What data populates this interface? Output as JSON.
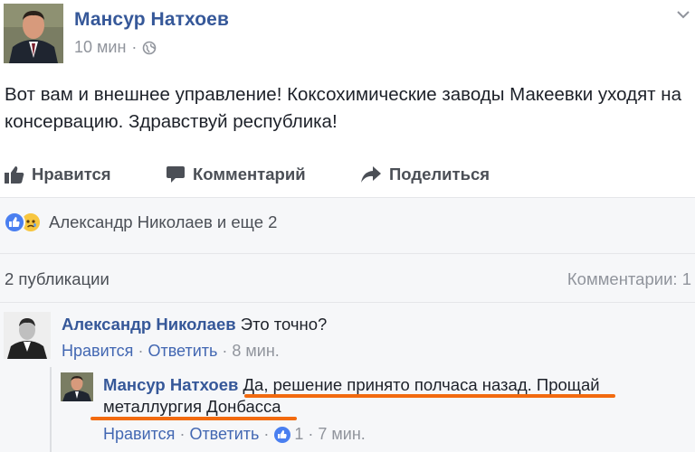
{
  "post": {
    "author": "Мансур Натхоев",
    "time": "10 мин",
    "separator": "·",
    "text": "Вот вам и внешнее управление! Коксохимические заводы Макеевки уходят на консервацию. Здравствуй республика!",
    "privacy_icon": "globe-icon",
    "menu_icon": "chevron-down-icon"
  },
  "actions": {
    "like_label": "Нравится",
    "comment_label": "Комментарий",
    "share_label": "Поделиться"
  },
  "reactions": {
    "icons": [
      "like-reaction-icon",
      "sad-reaction-icon"
    ],
    "text": "Александр Николаев и еще 2"
  },
  "stats": {
    "shares": "2 публикации",
    "comments": "Комментарии: 1"
  },
  "comments": [
    {
      "author": "Александр Николаев",
      "text": "Это точно?",
      "like_label": "Нравится",
      "reply_label": "Ответить",
      "time": "8 мин."
    }
  ],
  "reply": {
    "author": "Мансур Натхоев",
    "text": "Да, решение принято полчаса назад. Прощай металлургия Донбасса",
    "like_label": "Нравится",
    "reply_label": "Ответить",
    "like_count": "1",
    "time": "7 мин."
  },
  "colors": {
    "name": "#365899",
    "link": "#4267b2",
    "muted": "#90949c",
    "highlight_underline": "#f26a0f",
    "like_blue": "#4a7ff0",
    "sad_yellow": "#f7c640"
  }
}
